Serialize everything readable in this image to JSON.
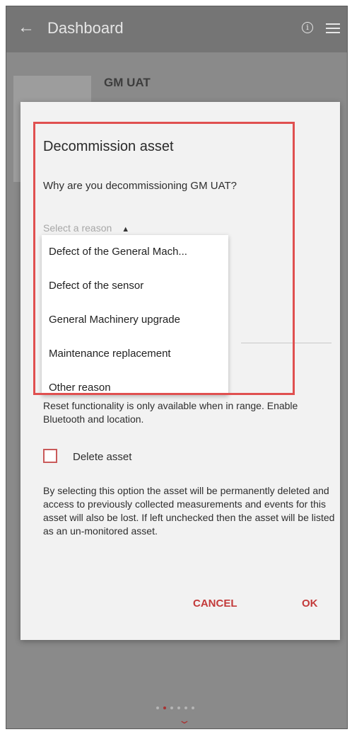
{
  "appbar": {
    "back_icon": "←",
    "title": "Dashboard",
    "info_icon": "i",
    "menu_icon": "hamburger-menu"
  },
  "background": {
    "asset_name": "GM UAT",
    "pager_count": 6,
    "pager_active_index": 1
  },
  "dialog": {
    "title": "Decommission asset",
    "question": "Why are you decommissioning GM UAT?",
    "select": {
      "placeholder": "Select a reason",
      "caret_icon": "▲"
    },
    "options": [
      "Defect of the General Mach...",
      "Defect of the sensor",
      "General Machinery upgrade",
      "Maintenance replacement",
      "Other reason"
    ],
    "reset_note": "Reset functionality is only available when in range. Enable Bluetooth and location.",
    "delete_label": "Delete asset",
    "delete_checked": false,
    "delete_description": "By selecting this option the asset will be permanently deleted and access to previously collected measurements and events for this asset will also be lost. If left unchecked then the asset will be listed as an un-monitored asset.",
    "cancel_label": "CANCEL",
    "ok_label": "OK"
  },
  "colors": {
    "accent": "#c33a3a",
    "highlight": "#e05050",
    "overlay": "#8a8a8a"
  }
}
